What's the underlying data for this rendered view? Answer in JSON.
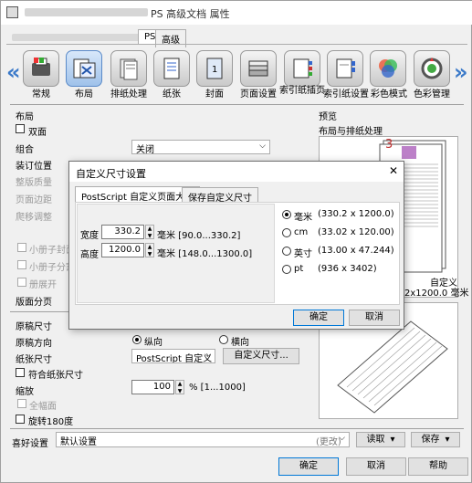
{
  "window": {
    "title_suffix": "PS 高级文档 属性"
  },
  "top_tabs": [
    "PS",
    "高级"
  ],
  "categories": [
    "常规",
    "布局",
    "排纸处理",
    "纸张",
    "封面",
    "页面设置",
    "索引纸插页",
    "索引纸设置",
    "彩色模式",
    "色彩管理"
  ],
  "layout_panel": {
    "heading": "布局",
    "duplex_label": "双面",
    "combine_label": "组合",
    "combine_value": "关闭",
    "binding_label": "装订位置",
    "quality_label": "整版质量",
    "gap_label": "页面边距",
    "shift_label": "爬移调整",
    "booklet1": "小册子封面",
    "booklet2": "小册子分割",
    "booklet3": "册展开",
    "pagination_label": "版面分页",
    "original_size_label": "原稿尺寸",
    "orientation_label": "原稿方向",
    "portrait": "纵向",
    "landscape": "横向",
    "paper_size_label": "纸张尺寸",
    "paper_size_value": "PostScript 自定义",
    "custom_size_button": "自定义尺寸...",
    "fit_paper_label": "符合纸张尺寸",
    "zoom_label": "缩放",
    "zoom_value": "100",
    "zoom_range": "% [1...1000]",
    "full_page_label": "全幅面",
    "rotate_label": "旋转180度"
  },
  "preview": {
    "heading": "预览",
    "subheading": "布局与排纸处理",
    "page_number": "3",
    "custom_label": "自定义",
    "size_label": "2x1200.0 毫米"
  },
  "footer": {
    "favorites_label": "喜好设置",
    "favorites_value": "默认设置",
    "changed": "(更改)",
    "load_button": "读取",
    "save_button": "保存",
    "ok_button": "确定",
    "cancel_button": "取消",
    "help_button": "帮助"
  },
  "dialog": {
    "title": "自定义尺寸设置",
    "close": "✕",
    "tabs": [
      "PostScript 自定义页面大小",
      "保存自定义尺寸"
    ],
    "width_label": "宽度",
    "width_value": "330.2",
    "width_unit": "毫米 [90.0...330.2]",
    "height_label": "高度",
    "height_value": "1200.0",
    "height_unit": "毫米 [148.0...1300.0]",
    "units": [
      {
        "label": "毫米",
        "value": "(330.2 x 1200.0)",
        "selected": true
      },
      {
        "label": "cm",
        "value": "(33.02 x 120.00)",
        "selected": false
      },
      {
        "label": "英寸",
        "value": "(13.00 x 47.244)",
        "selected": false
      },
      {
        "label": "pt",
        "value": "(936 x 3402)",
        "selected": false
      }
    ],
    "ok_button": "确定",
    "cancel_button": "取消"
  }
}
